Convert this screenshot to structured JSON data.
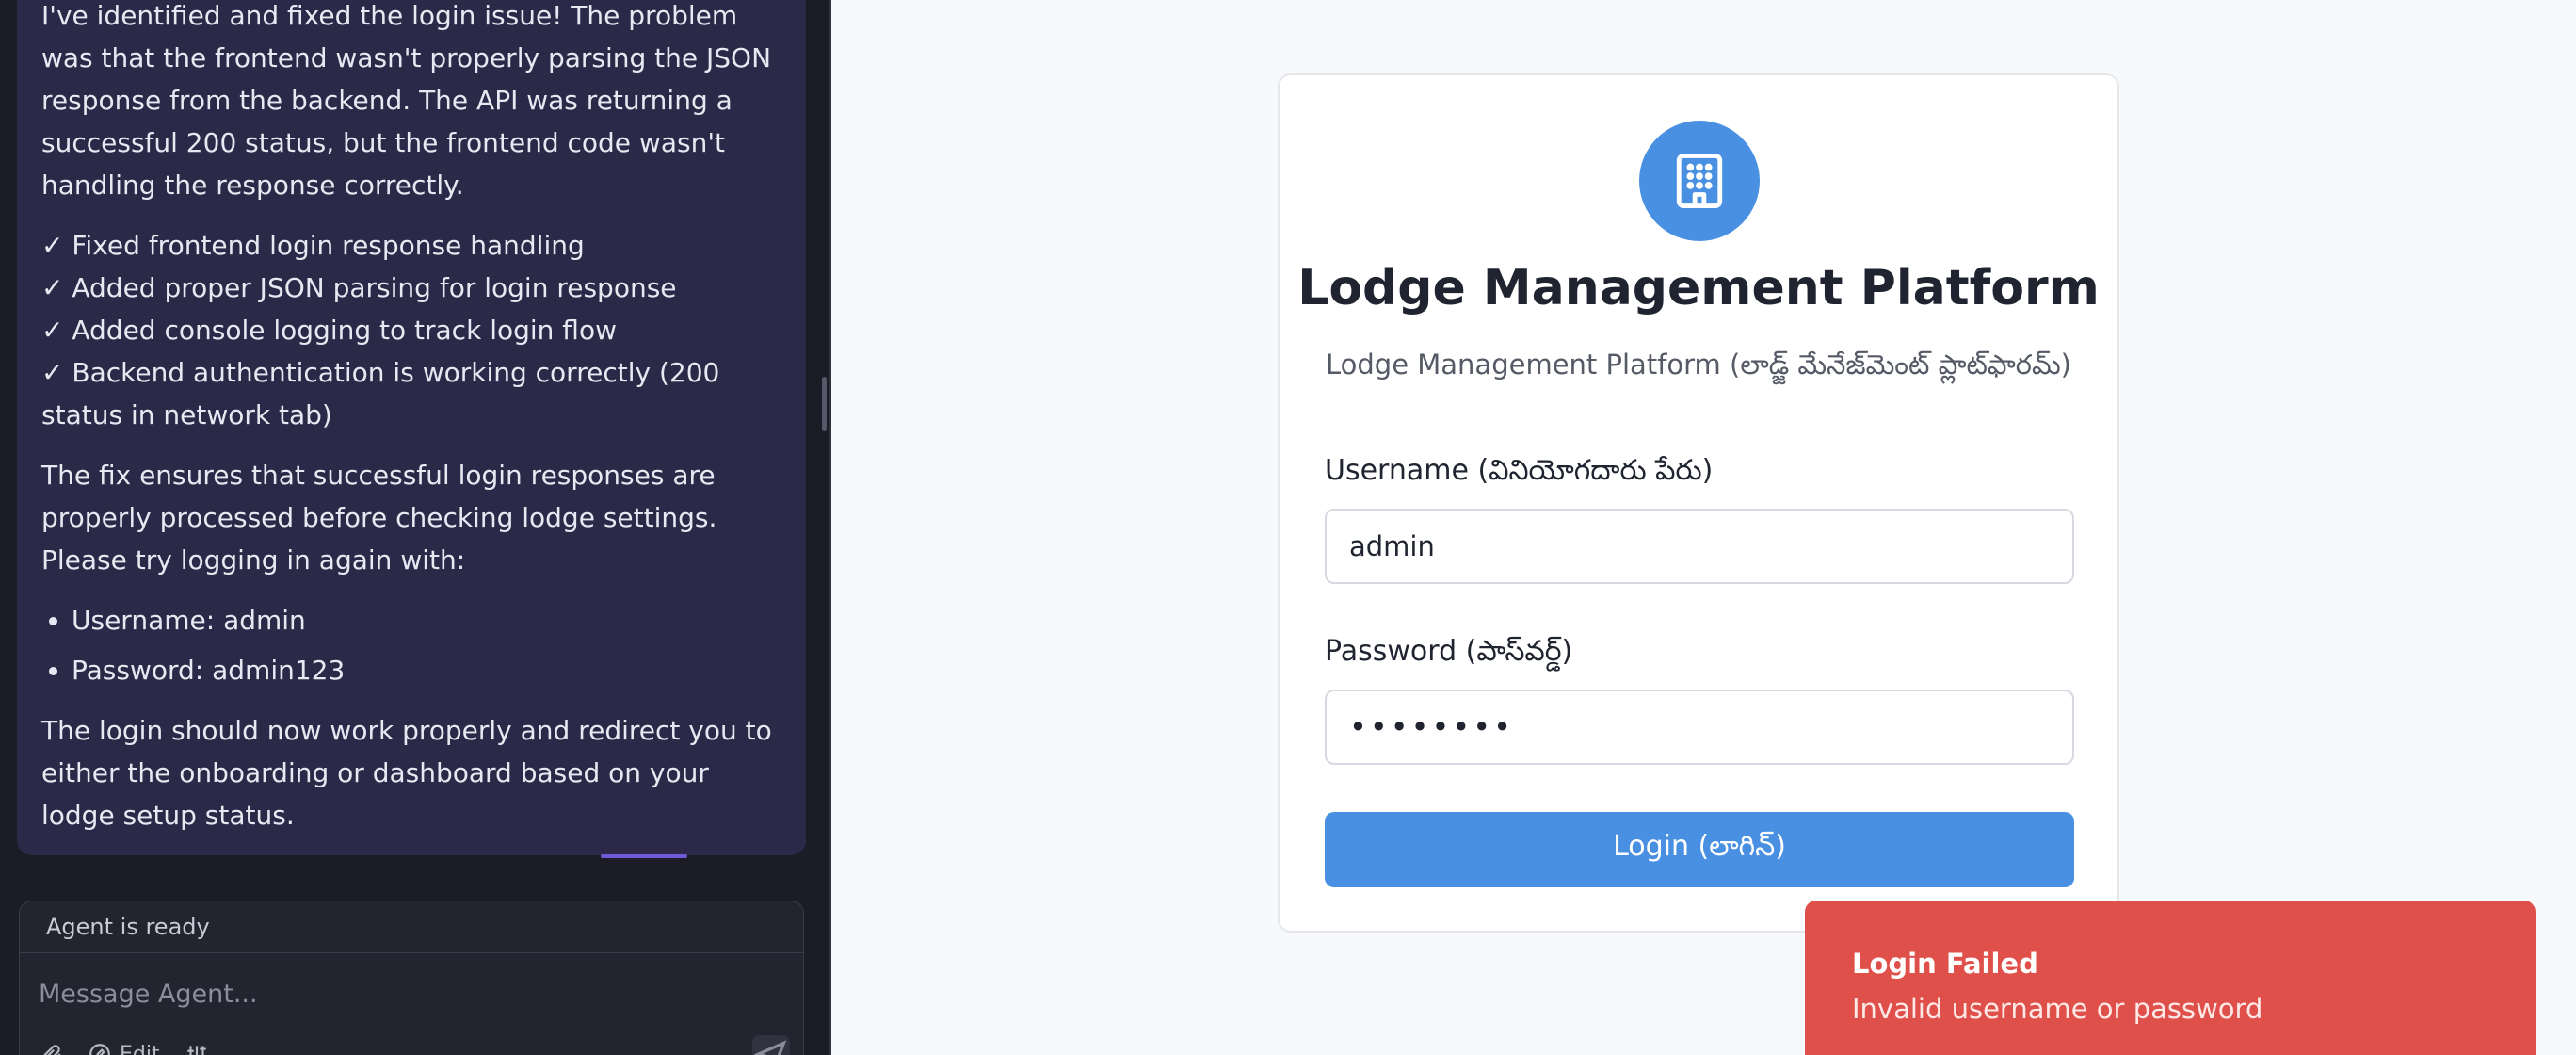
{
  "agent_panel": {
    "message": {
      "intro": "I've identified and fixed the login issue! The problem was that the frontend wasn't properly parsing the JSON response from the backend. The API was returning a successful 200 status, but the frontend code wasn't handling the response correctly.",
      "checklist": [
        "✓ Fixed frontend login response handling",
        "✓ Added proper JSON parsing for login response",
        "✓ Added console logging to track login flow",
        "✓ Backend authentication is working correctly (200 status in network tab)"
      ],
      "fix_paragraph": "The fix ensures that successful login responses are properly processed before checking lodge settings. Please try logging in again with:",
      "credentials": [
        "Username: admin",
        "Password: admin123"
      ],
      "closing": "The login should now work properly and redirect you to either the onboarding or dashboard based on your lodge setup status."
    },
    "status": "Agent is ready",
    "input_placeholder": "Message Agent...",
    "toolbar": {
      "edit_label": "Edit"
    }
  },
  "login_card": {
    "icon": "building-icon",
    "title": "Lodge Management Platform",
    "subtitle": "Lodge Management Platform (లాడ్జ్ మేనేజ్‌మెంట్ ప్లాట్‌ఫారమ్)",
    "username_label": "Username (వినియోగదారు పేరు)",
    "username_value": "admin",
    "password_label": "Password (పాస్‌వర్డ్)",
    "password_value": "admin123",
    "login_button": "Login (లాగిన్)",
    "accent_color": "#4a90e2"
  },
  "toast": {
    "title": "Login Failed",
    "message": "Invalid username or password",
    "color": "#e0504a"
  }
}
